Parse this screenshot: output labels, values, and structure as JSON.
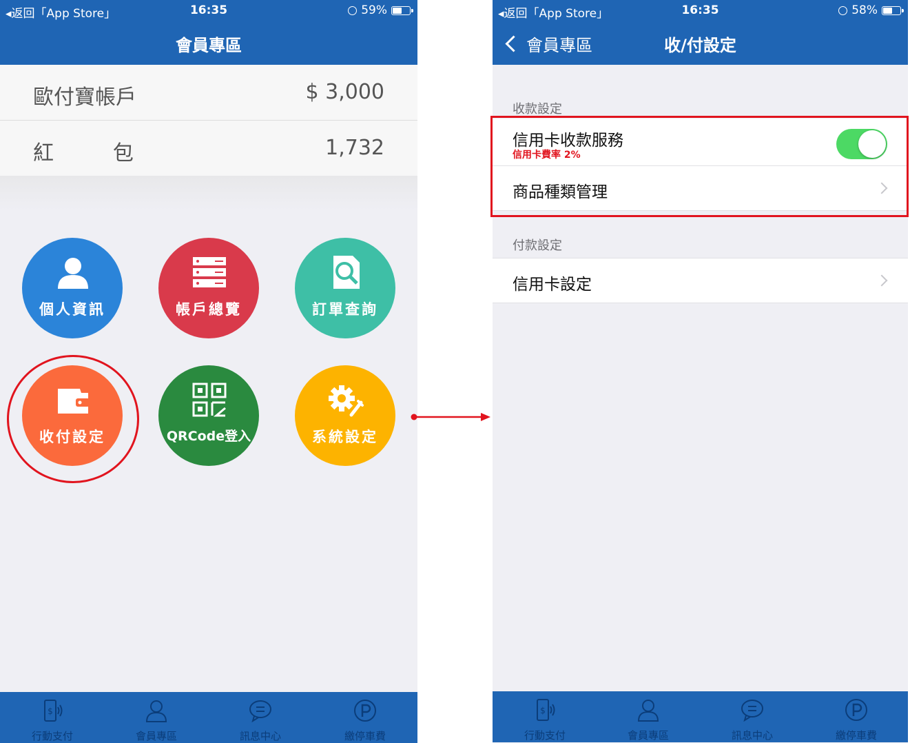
{
  "left": {
    "status": {
      "back": "返回「App Store」",
      "time": "16:35",
      "battery": "59%",
      "battery_level": 0.59
    },
    "nav_title": "會員專區",
    "account": [
      {
        "label": "歐付寶帳戶",
        "value": "$ 3,000"
      },
      {
        "label": "紅         包",
        "value": "1,732"
      }
    ],
    "menu": [
      {
        "label": "個人資訊",
        "icon": "person-icon",
        "color": "#2b84d9"
      },
      {
        "label": "帳戶總覽",
        "icon": "server-list-icon",
        "color": "#d93a4b"
      },
      {
        "label": "訂單查詢",
        "icon": "search-document-icon",
        "color": "#3ebfa6"
      },
      {
        "label": "收付設定",
        "icon": "wallet-icon",
        "color": "#fb6a3c"
      },
      {
        "label": "QRCode登入",
        "icon": "qrcode-icon",
        "color": "#2a8a3f"
      },
      {
        "label": "系統設定",
        "icon": "gear-wrench-icon",
        "color": "#fdb300"
      }
    ]
  },
  "right": {
    "status": {
      "back": "返回「App Store」",
      "time": "16:35",
      "battery": "58%",
      "battery_level": 0.58
    },
    "nav_back": "會員專區",
    "nav_title": "收/付設定",
    "receive_header": "收款設定",
    "credit_service": {
      "label": "信用卡收款服務",
      "sub": "信用卡費率 2%",
      "enabled": true
    },
    "product_mgmt": "商品種類管理",
    "pay_header": "付款設定",
    "credit_setting": "信用卡設定"
  },
  "tabs": [
    "行動支付",
    "會員專區",
    "訊息中心",
    "繳停車費"
  ],
  "colors": {
    "brand_blue": "#1f65b4",
    "highlight_red": "#e1141e",
    "toggle_green": "#4cd964"
  }
}
